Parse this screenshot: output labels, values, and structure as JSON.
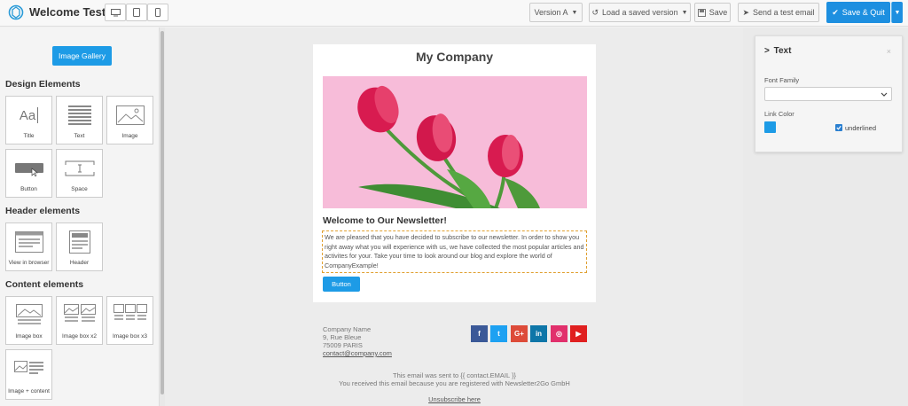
{
  "app": {
    "title": "Welcome Test"
  },
  "toolbar": {
    "version_label": "Version A",
    "load_label": "Load a saved version",
    "save_label": "Save",
    "test_email_label": "Send a test email",
    "save_quit_label": "Save & Quit"
  },
  "sidebar": {
    "gallery_label": "Image Gallery",
    "sections": {
      "design": "Design Elements",
      "header": "Header elements",
      "content": "Content elements"
    },
    "design_items": [
      "Title",
      "Text",
      "Image",
      "Button",
      "Space"
    ],
    "header_items": [
      "View in browser",
      "Header"
    ],
    "content_items": [
      "Image box",
      "Image box x2",
      "Image box x3",
      "Image + content"
    ],
    "title_glyph": "Aa"
  },
  "email": {
    "company": "My Company",
    "newsletter_title": "Welcome to Our Newsletter!",
    "body_text": "We are pleased that you have decided to subscribe to our newsletter. In order to show you right away what you will experience with us, we have collected the most popular articles and activites for your. Take your time to look around our blog and explore the world of CompanyExample!",
    "button_label": "Button",
    "address": {
      "name": "Company Name",
      "street": "9, Rue Bleue",
      "city": "75009 PARIS",
      "email": "contact@company.com"
    },
    "social": [
      {
        "icon": "facebook-icon",
        "glyph": "f",
        "color": "#3b5998"
      },
      {
        "icon": "twitter-icon",
        "glyph": "t",
        "color": "#1da1f2"
      },
      {
        "icon": "google-plus-icon",
        "glyph": "G+",
        "color": "#dd4b39"
      },
      {
        "icon": "linkedin-icon",
        "glyph": "in",
        "color": "#0e76a8"
      },
      {
        "icon": "instagram-icon",
        "glyph": "◎",
        "color": "#e1306c"
      },
      {
        "icon": "youtube-icon",
        "glyph": "▶",
        "color": "#e02020"
      }
    ],
    "footer_sent": "This email was sent to {{ contact.EMAIL }}",
    "footer_reason": "You received this email because you are registered with Newsletter2Go GmbH",
    "unsubscribe": "Unsubscribe here"
  },
  "text_panel": {
    "title": "Text",
    "close": "×",
    "font_family_label": "Font Family",
    "font_family_value": "",
    "link_color_label": "Link Color",
    "link_color": "#1d9be6",
    "underlined_label": "underlined",
    "underlined_checked": true
  },
  "colors": {
    "primary": "#1d8fe0",
    "hero_bg": "#f7bcd9"
  }
}
